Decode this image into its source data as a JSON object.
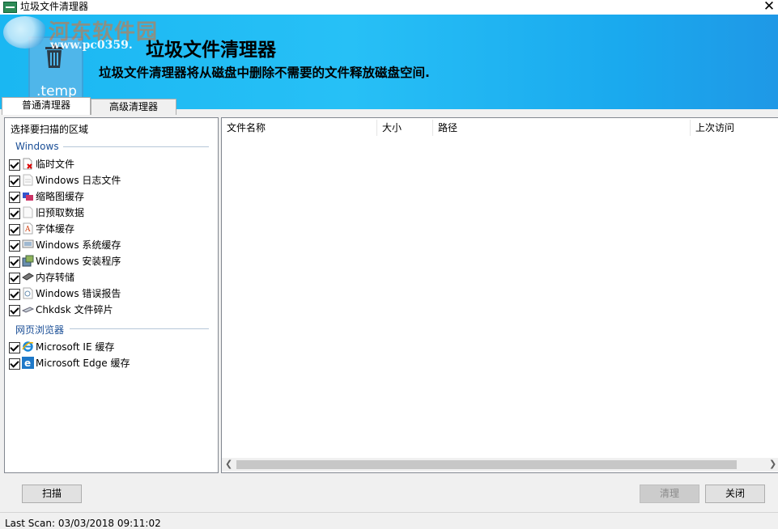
{
  "window": {
    "title": "垃圾文件清理器",
    "close_glyph": "✕"
  },
  "banner": {
    "title": "垃圾文件清理器",
    "subtitle": "垃圾文件清理器将从磁盘中删除不需要的文件释放磁盘空间.",
    "badge_label": ".temp",
    "watermark": "河东软件园",
    "watermark_url": "www.pc0359."
  },
  "tabs": [
    {
      "label": "普通清理器",
      "active": true
    },
    {
      "label": "高级清理器",
      "active": false
    }
  ],
  "scan_areas": {
    "header": "选择要扫描的区域",
    "groups": [
      {
        "label": "Windows",
        "items": [
          {
            "label": "临时文件",
            "checked": true,
            "icon": "temp-file-icon"
          },
          {
            "label": "Windows 日志文件",
            "checked": true,
            "icon": "log-file-icon"
          },
          {
            "label": "缩略图缓存",
            "checked": true,
            "icon": "thumbnail-icon"
          },
          {
            "label": "旧预取数据",
            "checked": true,
            "icon": "prefetch-file-icon"
          },
          {
            "label": "字体缓存",
            "checked": true,
            "icon": "font-icon"
          },
          {
            "label": "Windows 系统缓存",
            "checked": true,
            "icon": "system-cache-icon"
          },
          {
            "label": "Windows 安装程序",
            "checked": true,
            "icon": "installer-icon"
          },
          {
            "label": "内存转储",
            "checked": true,
            "icon": "memory-icon"
          },
          {
            "label": "Windows 错误报告",
            "checked": true,
            "icon": "error-report-icon"
          },
          {
            "label": "Chkdsk 文件碎片",
            "checked": true,
            "icon": "chkdsk-icon"
          }
        ]
      },
      {
        "label": "网页浏览器",
        "items": [
          {
            "label": "Microsoft IE 缓存",
            "checked": true,
            "icon": "ie-icon"
          },
          {
            "label": "Microsoft Edge 缓存",
            "checked": true,
            "icon": "edge-icon"
          }
        ]
      }
    ]
  },
  "file_list": {
    "columns": [
      "文件名称",
      "大小",
      "路径",
      "上次访问"
    ],
    "rows": []
  },
  "buttons": {
    "scan": "扫描",
    "clean": "清理",
    "close": "关闭"
  },
  "status": {
    "text": "Last Scan: 03/03/2018  09:11:02"
  },
  "colors": {
    "banner": "#1ab7f2",
    "group_label": "#1a4e96"
  }
}
